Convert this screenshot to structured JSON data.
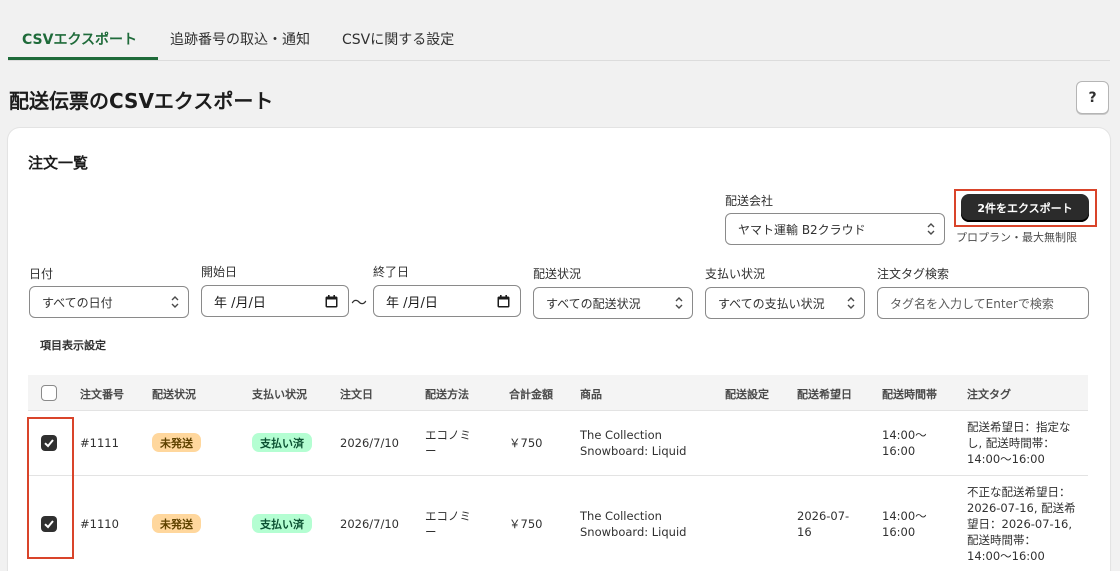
{
  "tabs": [
    {
      "label": "CSVエクスポート"
    },
    {
      "label": "追跡番号の取込・通知"
    },
    {
      "label": "CSVに関する設定"
    }
  ],
  "page": {
    "title": "配送伝票のCSVエクスポート",
    "help_label": "?"
  },
  "card": {
    "title": "注文一覧"
  },
  "carrier": {
    "label": "配送会社",
    "value": "ヤマト運輸 B2クラウド"
  },
  "export": {
    "button_label": "2件をエクスポート",
    "note": "プロプラン・最大無制限"
  },
  "filters": {
    "date_label": "日付",
    "date_value": "すべての日付",
    "start_label": "開始日",
    "start_value": "年 /月/日",
    "tilde": "〜",
    "end_label": "終了日",
    "end_value": "年 /月/日",
    "ship_status_label": "配送状況",
    "ship_status_value": "すべての配送状況",
    "pay_status_label": "支払い状況",
    "pay_status_value": "すべての支払い状況",
    "tag_label": "注文タグ検索",
    "tag_placeholder": "タグ名を入力してEnterで検索"
  },
  "column_settings_label": "項目表示設定",
  "table": {
    "headers": [
      "注文番号",
      "配送状況",
      "支払い状況",
      "注文日",
      "配送方法",
      "合計金額",
      "商品",
      "配送設定",
      "配送希望日",
      "配送時間帯",
      "注文タグ"
    ],
    "rows": [
      {
        "checked": true,
        "order": "#1111",
        "ship_status": "未発送",
        "pay_status": "支払い済",
        "date": "2026/7/10",
        "method": "エコノミー",
        "total": "￥750",
        "product": "The Collection Snowboard: Liquid",
        "setting": "",
        "wish_date": "",
        "time": "14:00〜16:00",
        "tag": "配送希望日：指定なし, 配送時間帯：14:00〜16:00"
      },
      {
        "checked": true,
        "order": "#1110",
        "ship_status": "未発送",
        "pay_status": "支払い済",
        "date": "2026/7/10",
        "method": "エコノミー",
        "total": "￥750",
        "product": "The Collection Snowboard: Liquid",
        "setting": "",
        "wish_date": "2026-07-16",
        "time": "14:00〜16:00",
        "tag": "不正な配送希望日：2026-07-16, 配送希望日：2026-07-16, 配送時間帯：14:00〜16:00"
      }
    ]
  },
  "colors": {
    "accent": "#1f6b3a",
    "highlight": "#d9442a",
    "badge_warn": "#ffd79d",
    "badge_ok": "#b4fed2"
  }
}
